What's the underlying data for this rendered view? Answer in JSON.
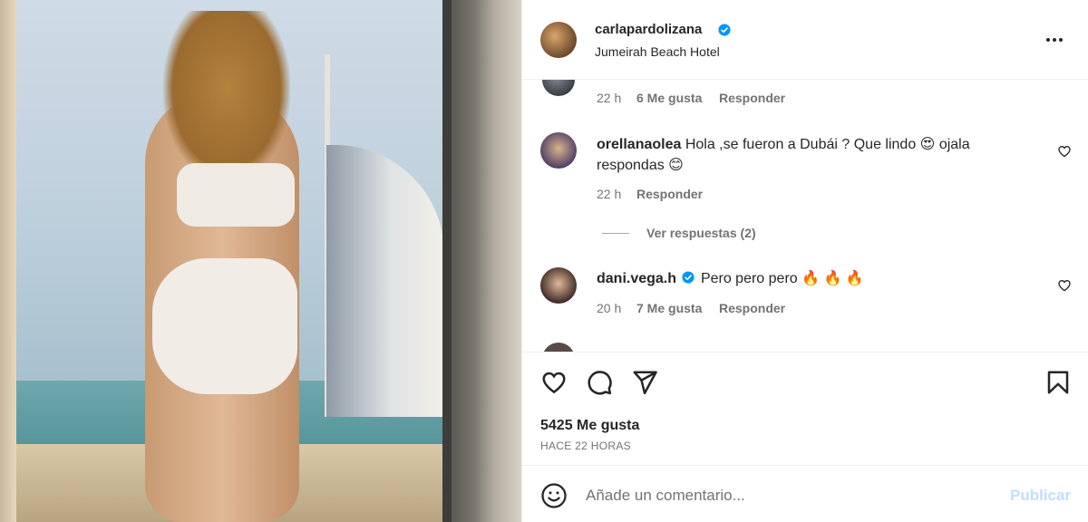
{
  "post": {
    "username": "carlapardolizana",
    "location": "Jumeirah Beach Hotel"
  },
  "comments": [
    {
      "time": "22 h",
      "likes": "6 Me gusta",
      "reply": "Responder"
    },
    {
      "username": "orellanaolea",
      "text_line1": "Hola ,se fueron a Dubái ? Que lindo",
      "emoji1": "😍",
      "text_line1b": "ojala",
      "text_line2": "respondas",
      "emoji2": "😊",
      "time": "22 h",
      "reply": "Responder",
      "view_replies": "Ver respuestas (2)"
    },
    {
      "username": "dani.vega.h",
      "text": "Pero pero pero",
      "emojis": "🔥 🔥 🔥",
      "time": "20 h",
      "likes": "7 Me gusta",
      "reply": "Responder"
    }
  ],
  "actions": {
    "likes": "5425 Me gusta",
    "time_ago": "HACE 22 HORAS"
  },
  "composer": {
    "placeholder": "Añade un comentario...",
    "publish": "Publicar"
  },
  "colors": {
    "verified": "#0095f6",
    "muted": "#737373",
    "publish_disabled": "#c0dffd"
  },
  "icons": [
    "more-options-icon",
    "verified-icon",
    "heart-icon",
    "comment-icon",
    "share-icon",
    "bookmark-icon",
    "emoji-icon"
  ]
}
